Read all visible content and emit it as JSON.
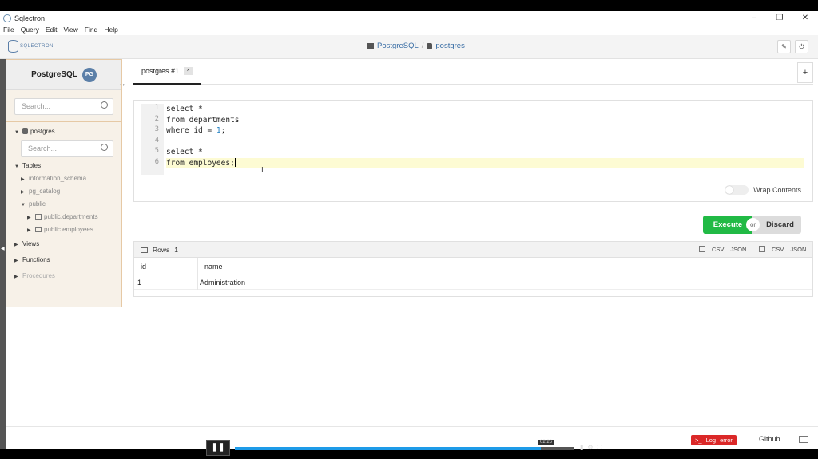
{
  "window": {
    "title": "Sqlectron",
    "controls": [
      "–",
      "❐",
      "✕"
    ]
  },
  "menu": [
    "File",
    "Query",
    "Edit",
    "View",
    "Find",
    "Help"
  ],
  "header": {
    "logo_text": "SQLECTRON",
    "breadcrumb_server": "PostgreSQL",
    "breadcrumb_db": "postgres"
  },
  "sidebar": {
    "server_name": "PostgreSQL",
    "search_placeholder": "Search...",
    "db_name": "postgres",
    "db_search_placeholder": "Search...",
    "tables_label": "Tables",
    "schemas": [
      "information_schema",
      "pg_catalog",
      "public"
    ],
    "public_tables": [
      "public.departments",
      "public.employees"
    ],
    "views_label": "Views",
    "functions_label": "Functions",
    "procedures_label": "Procedures"
  },
  "tabs": [
    {
      "label": "postgres #1",
      "close": "×"
    }
  ],
  "tab_add": "+",
  "editor": {
    "line_numbers": [
      "1",
      "2",
      "3",
      "4",
      "5",
      "6"
    ],
    "lines": [
      "select *",
      "from departments",
      "where id = 1;",
      "",
      "select *",
      "from employees;"
    ],
    "wrap_label": "Wrap Contents"
  },
  "actions": {
    "execute": "Execute",
    "or": "or",
    "discard": "Discard"
  },
  "results": {
    "rows_label": "Rows",
    "rows_count": "1",
    "export_csv": "CSV",
    "export_json": "JSON",
    "columns": [
      "id",
      "name"
    ],
    "rows": [
      [
        "1",
        "Administration"
      ]
    ]
  },
  "footer": {
    "log_label": "Log",
    "error_label": "error",
    "github_label": "Github"
  },
  "player": {
    "time": "02:26",
    "progress": 0.9
  },
  "colors": {
    "execute": "#21ba45",
    "log": "#db2828",
    "link": "#3a6ea5",
    "sidebar_border": "#e6c9a5"
  }
}
